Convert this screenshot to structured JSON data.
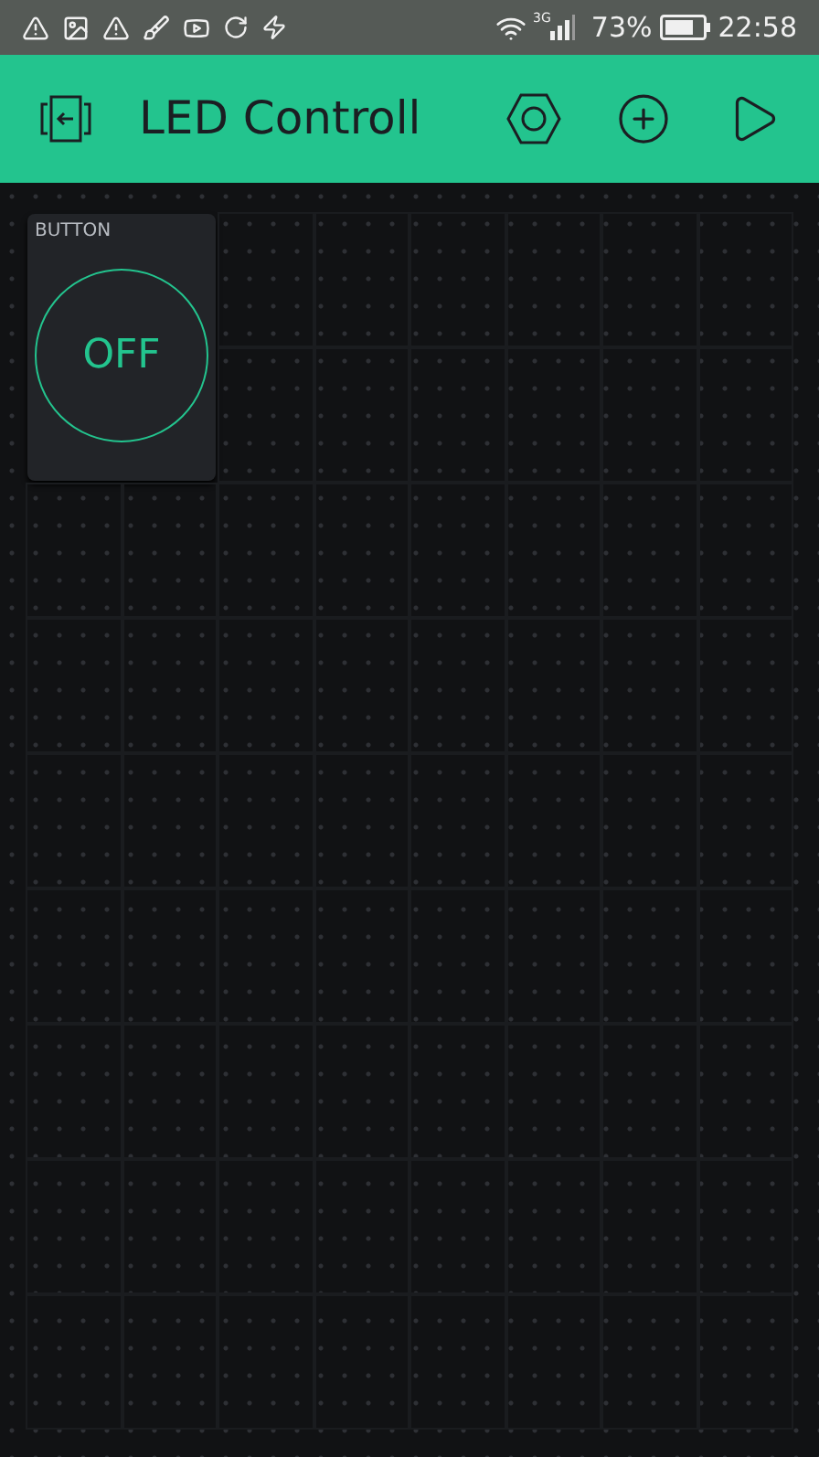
{
  "status_bar": {
    "network": "3G",
    "battery": "73%",
    "time": "22:58"
  },
  "header": {
    "title": "LED Controll"
  },
  "widgets": [
    {
      "kind": "button",
      "label": "BUTTON",
      "value": "OFF",
      "on": false
    }
  ]
}
